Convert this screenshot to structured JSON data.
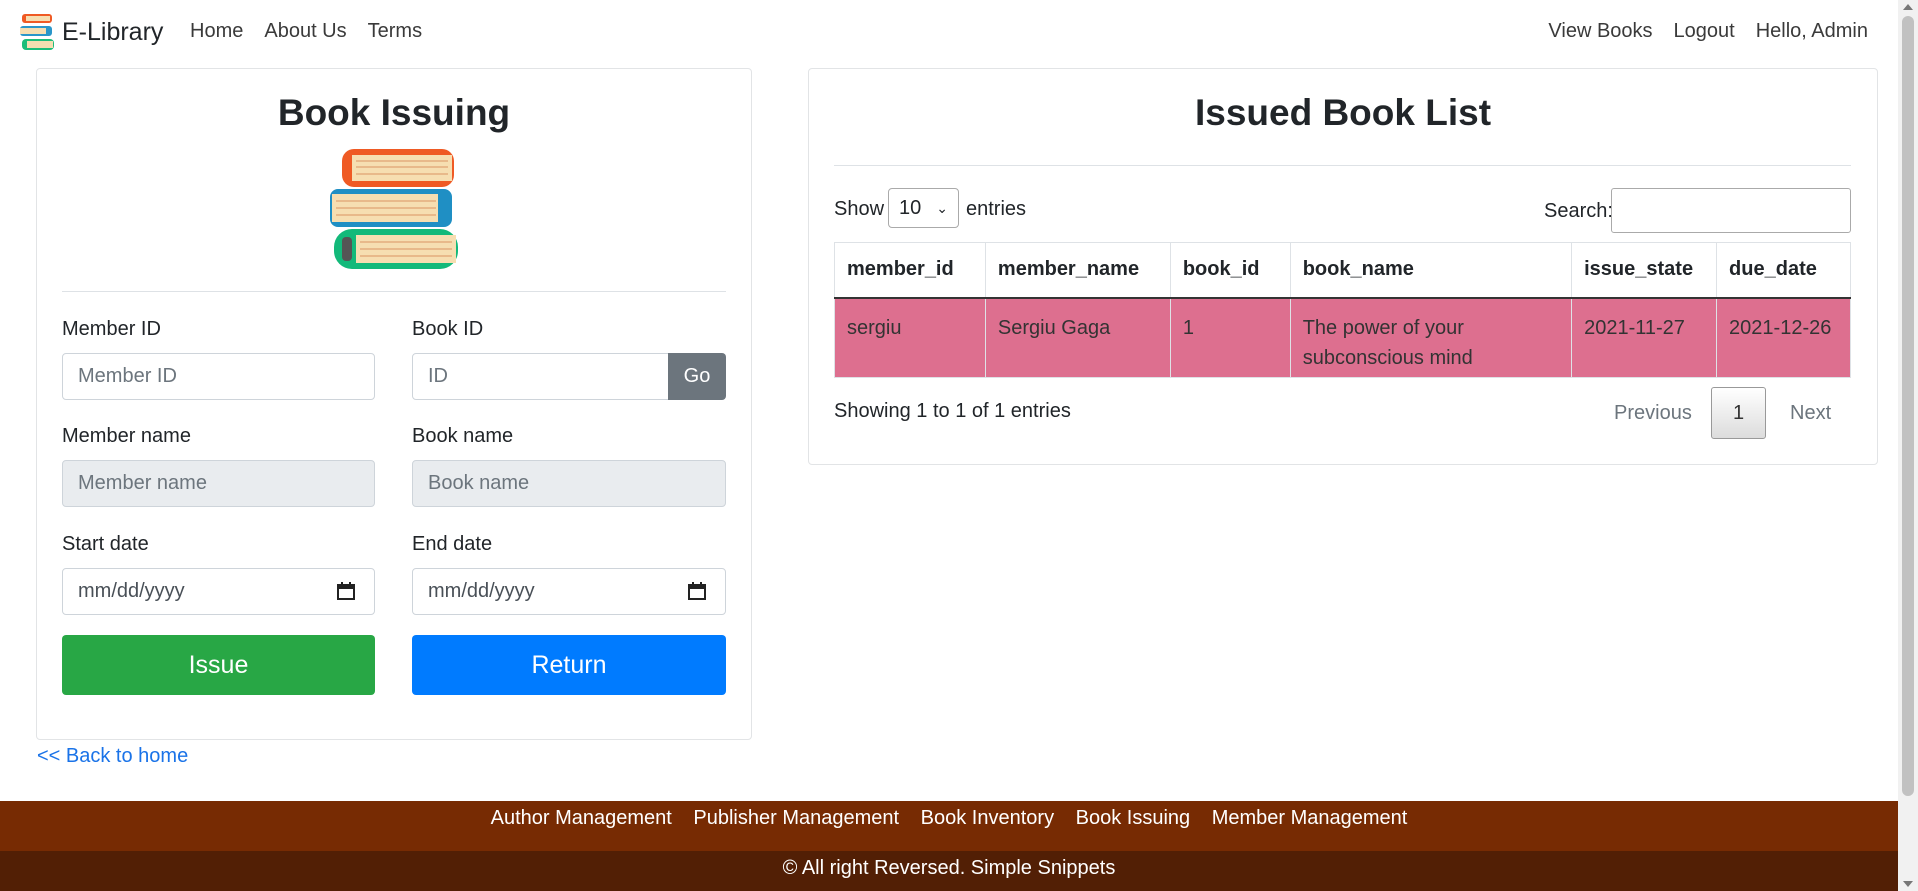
{
  "nav": {
    "brand": "E-Library",
    "left": [
      "Home",
      "About Us",
      "Terms"
    ],
    "right": [
      "View Books",
      "Logout",
      "Hello, Admin"
    ]
  },
  "form": {
    "title": "Book Issuing",
    "member_id": {
      "label": "Member ID",
      "placeholder": "Member ID"
    },
    "book_id": {
      "label": "Book ID",
      "placeholder": "ID",
      "go": "Go"
    },
    "member_name": {
      "label": "Member name",
      "placeholder": "Member name"
    },
    "book_name": {
      "label": "Book name",
      "placeholder": "Book name"
    },
    "start_date": {
      "label": "Start date",
      "placeholder": "mm/dd/yyyy"
    },
    "end_date": {
      "label": "End date",
      "placeholder": "mm/dd/yyyy"
    },
    "issue": "Issue",
    "return": "Return",
    "back": "<< Back to home"
  },
  "list": {
    "title": "Issued Book List",
    "show": "Show",
    "entries_count": "10",
    "entries": "entries",
    "search": "Search:",
    "columns": [
      "member_id",
      "member_name",
      "book_id",
      "book_name",
      "issue_state",
      "due_date"
    ],
    "rows": [
      [
        "sergiu",
        "Sergiu Gaga",
        "1",
        "The power of your subconscious mind",
        "2021-11-27",
        "2021-12-26"
      ]
    ],
    "info": "Showing 1 to 1 of 1 entries",
    "previous": "Previous",
    "page": "1",
    "next": "Next",
    "row_color": "#dd6f8f"
  },
  "footer": {
    "links": [
      "Author Management",
      "Publisher Management",
      "Book Inventory",
      "Book Issuing",
      "Member Management"
    ],
    "copyright": "© All right Reversed. Simple Snippets"
  }
}
